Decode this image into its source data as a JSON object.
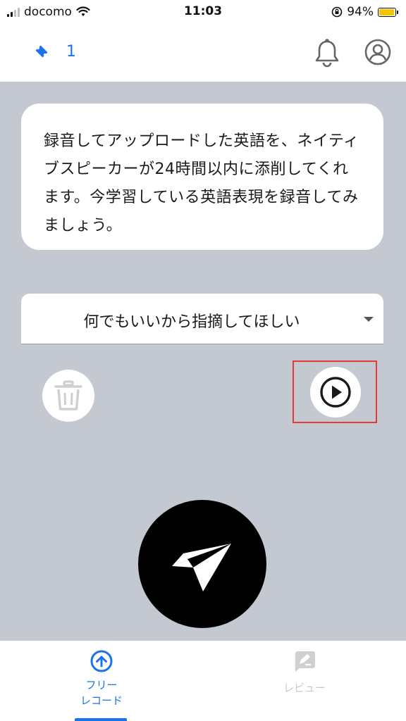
{
  "status_bar": {
    "carrier": "docomo",
    "time": "11:03",
    "battery_percent": "94%",
    "battery_level": 0.94
  },
  "header": {
    "ticket_count": "1"
  },
  "message": {
    "text": "録音してアップロードした英語を、ネイティブスピーカーが24時間以内に添削してくれます。今学習している英語表現を録音してみましょう。"
  },
  "dropdown": {
    "selected": "何でもいいから指摘してほしい"
  },
  "tabs": {
    "free_record_line1": "フリー",
    "free_record_line2": "レコード",
    "review": "レビュー"
  },
  "colors": {
    "accent": "#1a73e8",
    "main_background": "#c3c8d1",
    "highlight": "#e53935",
    "battery": "#f5c400"
  },
  "icons": {
    "ticket": "ticket-icon",
    "bell": "bell-icon",
    "profile": "profile-icon",
    "trash": "trash-icon",
    "play": "play-icon",
    "send": "send-icon",
    "upload": "upload-circle-icon",
    "review": "edit-icon"
  }
}
